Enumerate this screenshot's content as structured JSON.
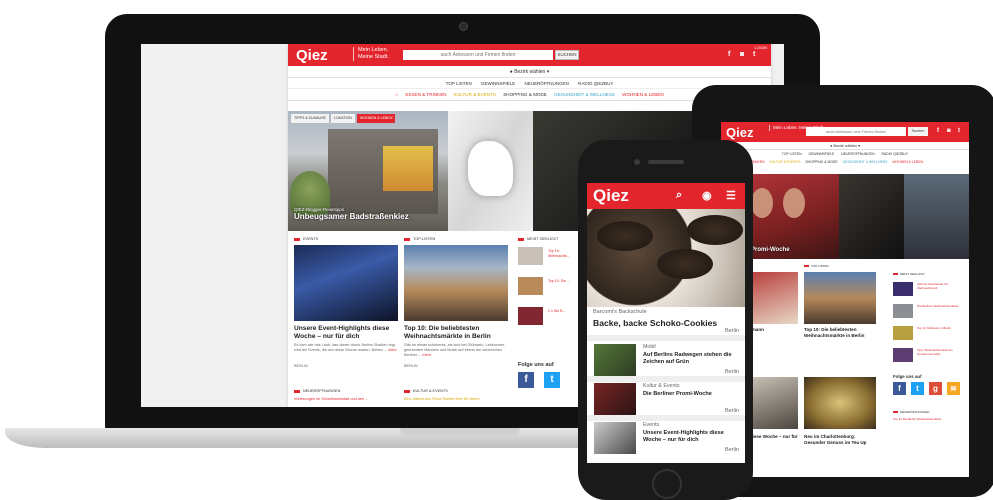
{
  "laptop_site": {
    "logo": "Qiez",
    "claim": "Mein Leben. Meine Stadt.",
    "search_placeholder": "auch Adressen und Firmen finden",
    "search_button": "SUCHEN",
    "topline": "LOGIN",
    "district": "Bezirk wählen",
    "nav_top": [
      "TOP LISTEN",
      "GEWINNSPIELE",
      "NEUERÖFFNUNGEN",
      "RADIO QIEZBUY"
    ],
    "nav_main": [
      {
        "label": "ESSEN & TRINKEN",
        "color": "#e3262e"
      },
      {
        "label": "KULTUR & EVENTS",
        "color": "#d6a800"
      },
      {
        "label": "SHOPPING & MODE",
        "color": "#333333"
      },
      {
        "label": "GESUNDHEIT & WELLNESS",
        "color": "#3aa3c8"
      },
      {
        "label": "WOHNEN & LEBEN",
        "color": "#e3262e"
      }
    ],
    "hero_tabs": [
      "TIPPS & ZUHAUSE",
      "LOKATION",
      "WOHNEN & LEBEN"
    ],
    "hero_kicker": "QIEZ-Blogger-Reisetipps",
    "hero_title": "Unbeugsamer Badstraßenkiez",
    "col1_head": "EVENTS",
    "col2_head": "TOP-LISTEN",
    "col3_head": "MEIST GEKLICKT",
    "card1_title": "Unsere Event-Highlights diese Woche – nur für dich",
    "card1_text": "Es kam wie das Laub, das dieser durch Berlins Straßen fegt, sind die Events, die uns diese Woche warten. Neben ...",
    "card1_more": "mehr",
    "card1_city": "BERLIN",
    "card2_title": "Top 10: Die beliebtesten Weihnachtsmärkte in Berlin",
    "card2_text": "Gibt es etwas schöneres, als sich bei Glühwein, Lebkuchen, gebrannten Mandeln und Musik auf einem der zahlreichen Berliner ...",
    "card2_more": "mehr",
    "card2_city": "BERLIN",
    "side_items": [
      "Top 10: Weihnachts...",
      "Top 10: Die ...",
      "2 x Die B..."
    ],
    "follow": "Folge uns auf",
    "bottom_head1": "NEUERÖFFNUNGEN",
    "bottom_head2": "KULTUR & EVENTS",
    "bottom_text1": "Vorlesungen im Schreibwerkstatt und den ...",
    "bottom_text2": "Eine Alltzeit aus Fritze Rubble feier 8G feiern"
  },
  "tablet_site": {
    "logo": "Qiez",
    "claim": "Mein Leben. Meine Stadt.",
    "search_placeholder": "auch Adressen und Firmen finden",
    "search_button": "Suchen",
    "district": "Bezirk wählen",
    "nav_top": [
      "TOP LISTEN",
      "GEWINNSPIELE",
      "NEUERÖFFNUNGEN",
      "RADIO QIEZBUY"
    ],
    "nav_main": [
      "ESSEN & TRINKEN",
      "KULTUR & EVENTS",
      "SHOPPING & MODE",
      "GESUNDHEIT & WELLNESS",
      "WOHNEN & LEBEN"
    ],
    "hero_caption": "Promi-Woche",
    "col_head1": "EVENTS",
    "col_head2": "TOP-LISTEN",
    "col_head3": "MEIST GEKLICKT",
    "card1_title": "Weihnachtsmann",
    "card2_title": "Top 10: Die beliebtesten Weihnachtsmärkte in Berlin",
    "card3_title": "Highlights diese Woche – nur für dich",
    "card4_title": "Neu im Charlottenburg: Gesunder Genuss im Tea Up",
    "follow": "Folge uns auf",
    "side_texts": [
      "Schöne Geschenke zur Weihnachtszeit",
      "Die Berliner Weihnachtsmärkte",
      "Top 10 Glühwein in Berlin",
      "Tipp: Weihnachtsmarkt am Gendarmenmarkt"
    ],
    "bottom_head": "NEUERÖFFNUNGEN",
    "bottom_side": "Top 10 Die Berlin Weihnachtsmärkte"
  },
  "phone_site": {
    "logo": "Qiez",
    "hero_kicker": "Barcomi's Backschule",
    "hero_title": "Backe, backe Schoko-Cookies",
    "hero_city": "Berlin",
    "items": [
      {
        "category": "Mobil",
        "title": "Auf Berlins Radwegen stehen die Zeichen auf Grün",
        "city": "Berlin"
      },
      {
        "category": "Kultur & Events",
        "title": "Die Berliner Promi-Woche",
        "city": "Berlin"
      },
      {
        "category": "Events",
        "title": "Unsere Event-Highlights diese Woche – nur für dich",
        "city": "Berlin"
      }
    ]
  },
  "colors": {
    "brand_red": "#e3262e",
    "facebook": "#3b5998",
    "twitter": "#1da1f2",
    "google": "#dd4b39",
    "rss": "#f5a623"
  }
}
